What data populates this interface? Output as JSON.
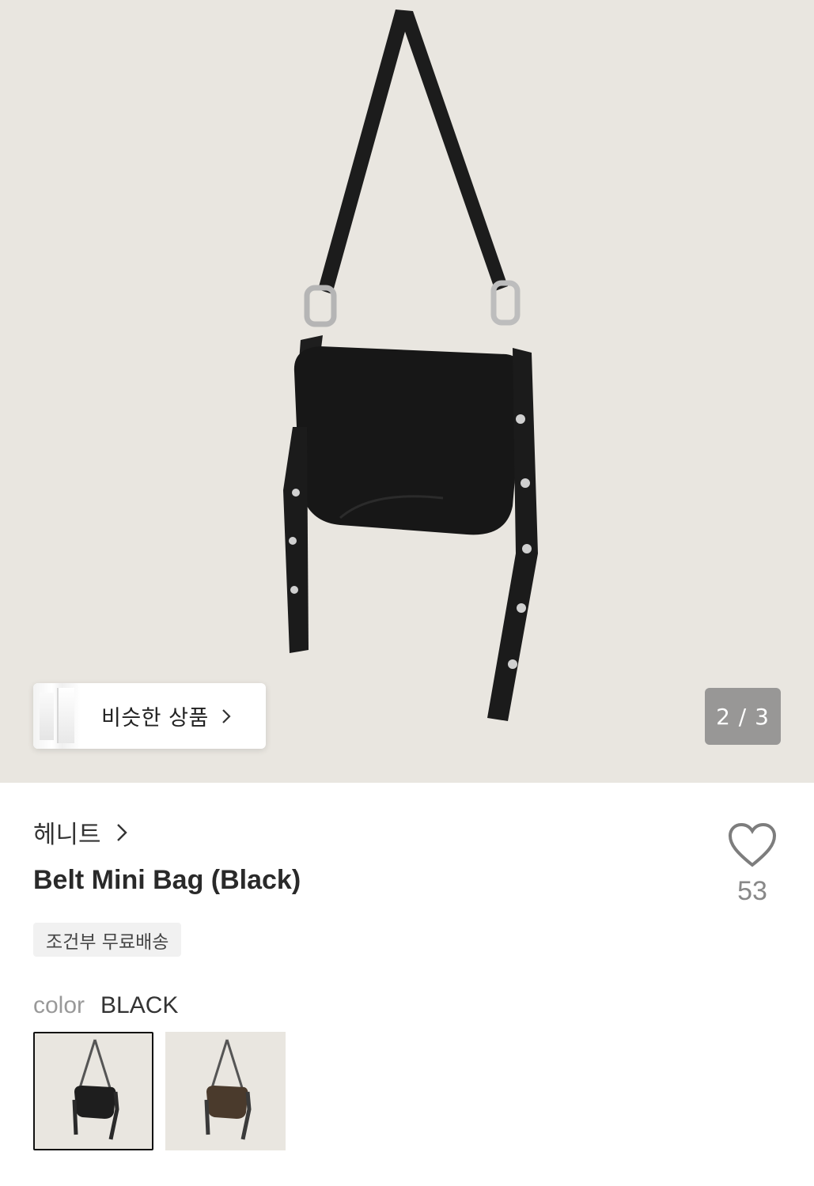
{
  "gallery": {
    "current": 2,
    "total": 3,
    "indicator_text": "2 / 3",
    "background_color": "#e9e6e0"
  },
  "similar_products": {
    "label": "비슷한 상품"
  },
  "product": {
    "brand": "헤니트",
    "title": "Belt Mini Bag (Black)",
    "like_count": "53",
    "shipping_badge": "조건부 무료배송"
  },
  "options": {
    "color_label": "color",
    "color_selected": "BLACK",
    "swatches": [
      {
        "name": "black",
        "color": "#1e1e1e",
        "selected": true
      },
      {
        "name": "brown",
        "color": "#4a3a2c",
        "selected": false
      }
    ]
  },
  "icons": {
    "like": "heart-icon",
    "brand_chevron": "chevron-right-icon",
    "similar_chevron": "chevron-right-icon"
  }
}
